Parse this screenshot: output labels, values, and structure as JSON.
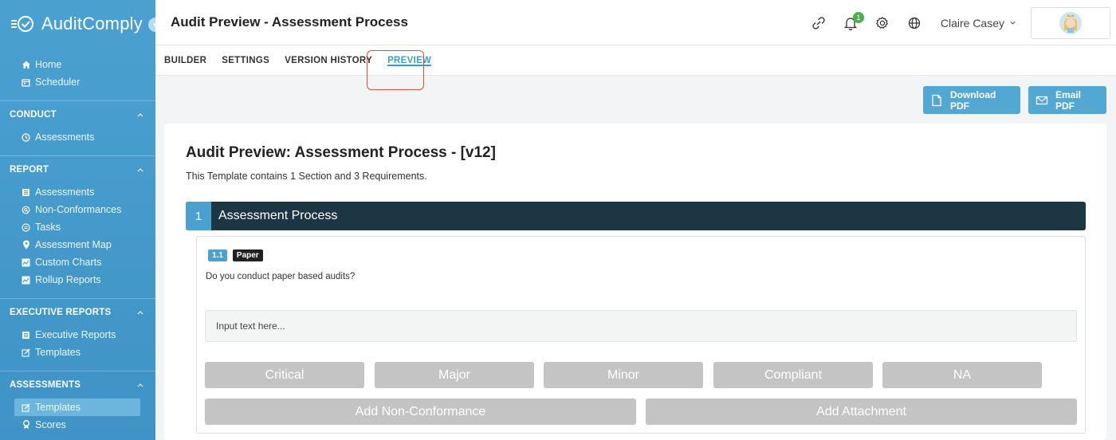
{
  "brand": {
    "name": "AuditComply"
  },
  "sidebar": {
    "top_items": [
      {
        "label": "Home",
        "icon": "home-icon"
      },
      {
        "label": "Scheduler",
        "icon": "calendar-icon"
      }
    ],
    "sections": [
      {
        "title": "CONDUCT",
        "items": [
          {
            "label": "Assessments",
            "icon": "clock-icon"
          }
        ]
      },
      {
        "title": "REPORT",
        "items": [
          {
            "label": "Assessments",
            "icon": "list-icon"
          },
          {
            "label": "Non-Conformances",
            "icon": "search-icon"
          },
          {
            "label": "Tasks",
            "icon": "tasks-icon"
          },
          {
            "label": "Assessment Map",
            "icon": "map-pin-icon"
          },
          {
            "label": "Custom Charts",
            "icon": "chart-icon"
          },
          {
            "label": "Rollup Reports",
            "icon": "chart-icon"
          }
        ]
      },
      {
        "title": "EXECUTIVE REPORTS",
        "items": [
          {
            "label": "Executive Reports",
            "icon": "list-icon"
          },
          {
            "label": "Templates",
            "icon": "edit-icon"
          }
        ]
      },
      {
        "title": "ASSESSMENTS",
        "items": [
          {
            "label": "Templates",
            "icon": "edit-icon",
            "active": true
          },
          {
            "label": "Scores",
            "icon": "award-icon"
          }
        ]
      }
    ]
  },
  "header": {
    "title": "Audit Preview - Assessment Process",
    "notification_count": "1",
    "user_name": "Claire Casey"
  },
  "tabs": [
    {
      "label": "BUILDER"
    },
    {
      "label": "SETTINGS"
    },
    {
      "label": "VERSION HISTORY"
    },
    {
      "label": "PREVIEW",
      "active": true
    }
  ],
  "actions": {
    "download_pdf": "Download PDF",
    "email_pdf": "Email PDF"
  },
  "document": {
    "title": "Audit Preview: Assessment Process - [v12]",
    "subtitle": "This Template contains 1 Section and 3 Requirements.",
    "section": {
      "number": "1",
      "name": "Assessment Process"
    },
    "requirement": {
      "number": "1.1",
      "tag": "Paper",
      "question": "Do you conduct paper based audits?",
      "input_placeholder": "Input text here...",
      "options": [
        "Critical",
        "Major",
        "Minor",
        "Compliant",
        "NA"
      ],
      "add_nc": "Add Non-Conformance",
      "add_attachment": "Add Attachment"
    }
  },
  "colors": {
    "sidebar": "#4aa1d0",
    "accent": "#3d9dc9",
    "section_bar": "#1c3743",
    "disabled_button": "#c4c4c4",
    "highlight": "#d9533b"
  }
}
